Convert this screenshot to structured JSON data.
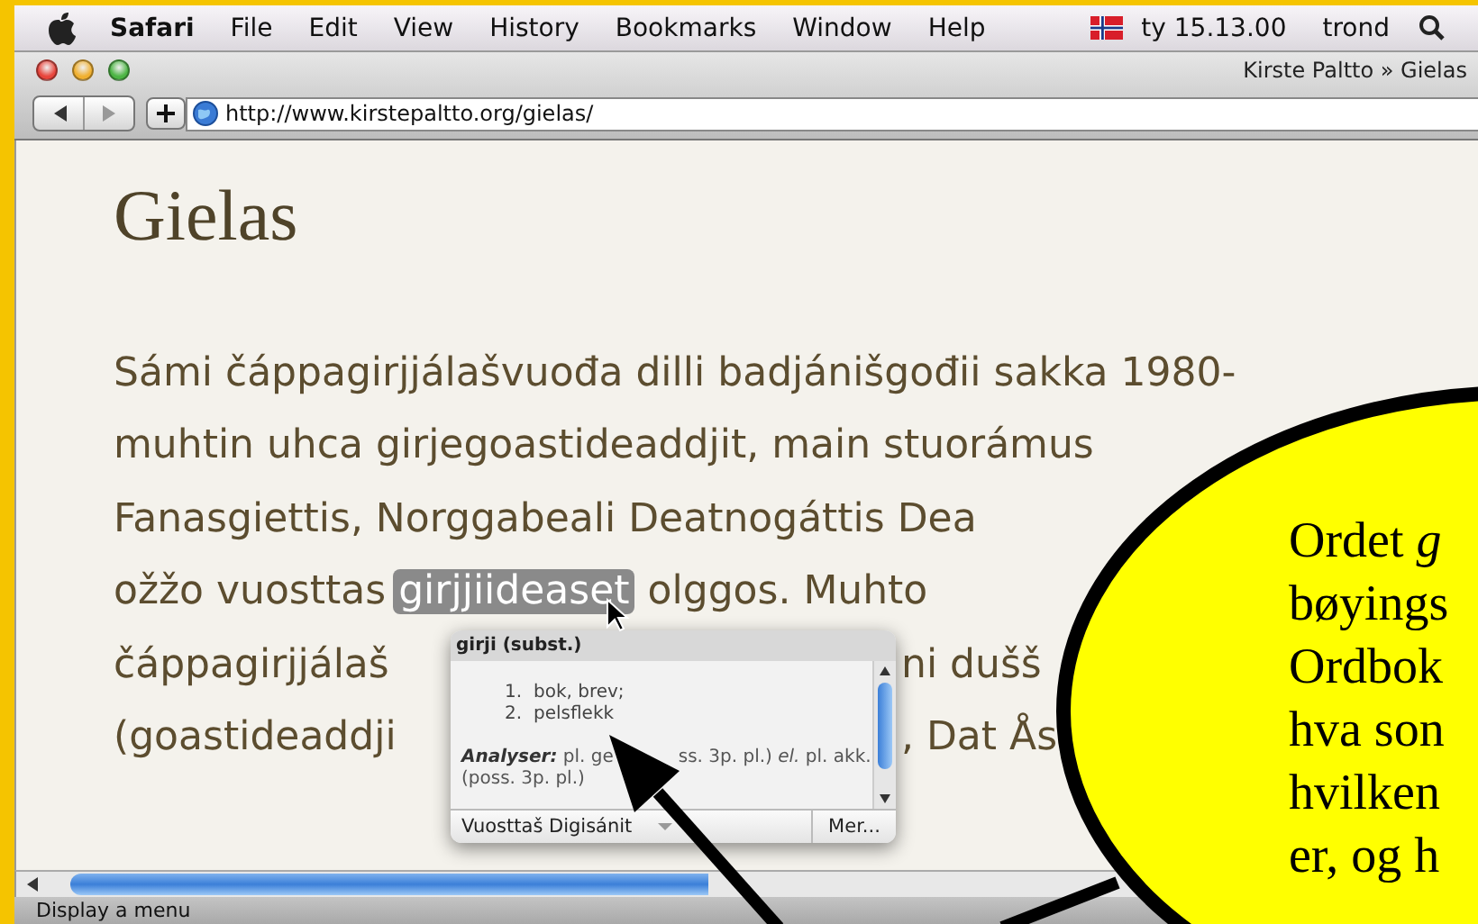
{
  "menubar": {
    "app": "Safari",
    "menus": [
      "File",
      "Edit",
      "View",
      "History",
      "Bookmarks",
      "Window",
      "Help"
    ],
    "clock": "ty 15.13.00",
    "user": "trond"
  },
  "window": {
    "title": "Kirste Paltto » Gielas",
    "address": "http://www.kirstepaltto.org/gielas/"
  },
  "page": {
    "heading": "Gielas",
    "lines": [
      [
        {
          "text": "Sámi čáppagirjjálašvuođa dilli badjánišgođii sakka 1980-",
          "kind": "plain"
        }
      ],
      [
        {
          "text": "muhtin uhca girjegoastideaddjit, main stuorámus",
          "kind": "plain"
        }
      ],
      [
        {
          "text": "Fanasgiettis, Norggabeali Deatnogáttis Dea",
          "kind": "plain"
        }
      ],
      [
        {
          "text": "ožžo vuosttas",
          "kind": "plain"
        },
        {
          "text": "girjjiideaset",
          "kind": "highlight"
        },
        {
          "text": "olggos. Muhto",
          "kind": "plain"
        }
      ],
      [
        {
          "text": "čáppagirjjálaš",
          "kind": "plain"
        },
        {
          "text": "ni dušš",
          "kind": "after-gap"
        }
      ],
      [
        {
          "text": "(goastideaddji",
          "kind": "plain"
        },
        {
          "text": ", Dat Ås",
          "kind": "after-gap"
        }
      ]
    ]
  },
  "popup": {
    "title": "girji (subst.)",
    "senses": [
      {
        "number": "1.",
        "text": "bok, brev;"
      },
      {
        "number": "2.",
        "text": "pelsflekk"
      }
    ],
    "analyser_label": "Analyser:",
    "analyser_parts": [
      "pl. ge",
      "ss. 3p. pl.) *el.* pl. akk. (poss. 3p. pl.)"
    ],
    "dictionary": "Vuosttaš Digisánit",
    "more": "Mer..."
  },
  "callout": {
    "lines": [
      "Ordet *g*",
      "bøyings",
      "Ordbok",
      "hva son",
      "hvilken",
      "er, og h"
    ]
  },
  "status_bar": {
    "text": "Display a menu"
  }
}
